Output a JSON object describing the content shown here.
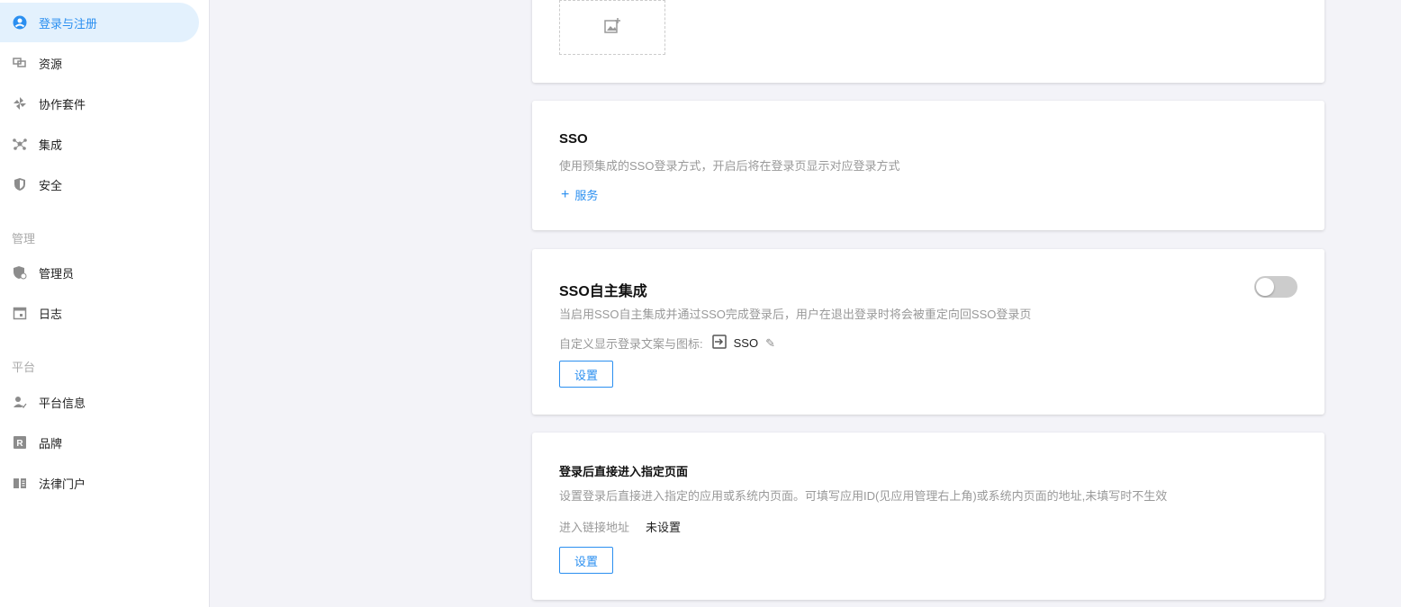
{
  "sidebar": {
    "items": [
      {
        "label": "登录与注册",
        "icon": "user-circle-icon"
      },
      {
        "label": "资源",
        "icon": "resource-icon"
      },
      {
        "label": "协作套件",
        "icon": "pinwheel-icon"
      },
      {
        "label": "集成",
        "icon": "integration-icon"
      },
      {
        "label": "安全",
        "icon": "shield-icon"
      }
    ],
    "section_manage": "管理",
    "manage_items": [
      {
        "label": "管理员",
        "icon": "admin-icon"
      },
      {
        "label": "日志",
        "icon": "calendar-icon"
      }
    ],
    "section_platform": "平台",
    "platform_items": [
      {
        "label": "平台信息",
        "icon": "user-check-icon"
      },
      {
        "label": "品牌",
        "icon": "brand-icon"
      },
      {
        "label": "法律门户",
        "icon": "book-icon"
      }
    ]
  },
  "sso": {
    "title": "SSO",
    "desc": "使用预集成的SSO登录方式，开启后将在登录页显示对应登录方式",
    "add_label": "服务"
  },
  "sso_custom": {
    "title": "SSO自主集成",
    "desc": "当启用SSO自主集成并通过SSO完成登录后，用户在退出登录时将会被重定向回SSO登录页",
    "custom_label": "自定义显示登录文案与图标:",
    "custom_value": "SSO",
    "button": "设置",
    "enabled": false
  },
  "redirect": {
    "title": "登录后直接进入指定页面",
    "desc": "设置登录后直接进入指定的应用或系统内页面。可填写应用ID(见应用管理右上角)或系统内页面的地址,未填写时不生效",
    "field_label": "进入链接地址",
    "field_value": "未设置",
    "button": "设置"
  },
  "colors": {
    "accent": "#2b8ff0"
  }
}
